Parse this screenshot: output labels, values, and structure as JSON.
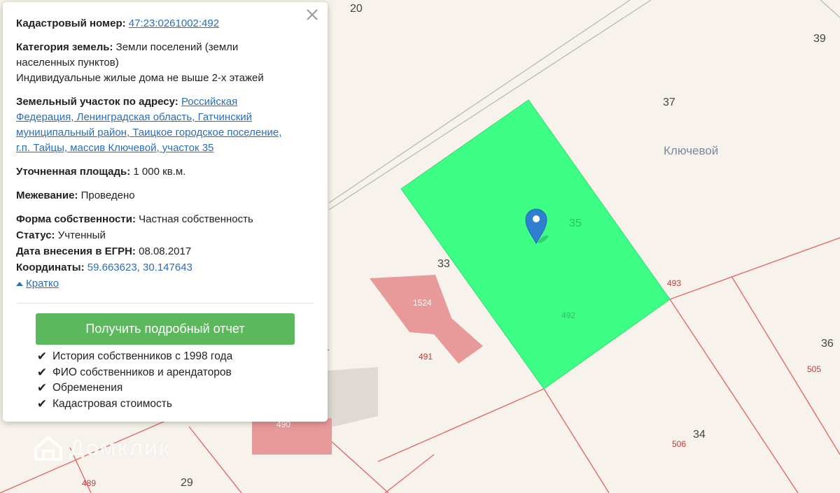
{
  "popup": {
    "cadastral_label": "Кадастровый номер:",
    "cadastral_number": "47:23:0261002:492",
    "category_label": "Категория земель:",
    "category_value_line1": "Земли поселений (земли",
    "category_value_line2": "населенных пунктов)",
    "permitted_use": "Индивидуальные жилые дома не выше 2-х этажей",
    "address_label": "Земельный участок по адресу:",
    "address_line1": "Российская",
    "address_line2": "Федерация, Ленинградская область, Гатчинский",
    "address_line3": "муниципальный район, Таицкое городское поселение,",
    "address_line4": "г.п. Тайцы, массив Ключевой, участок 35",
    "area_label": "Уточненная площадь:",
    "area_value": "1 000 кв.м.",
    "survey_label": "Межевание:",
    "survey_value": "Проведено",
    "ownership_label": "Форма собственности:",
    "ownership_value": "Частная собственность",
    "status_label": "Статус:",
    "status_value": "Учтенный",
    "egrn_date_label": "Дата внесения в ЕГРН:",
    "egrn_date_value": "08.08.2017",
    "coords_label": "Координаты:",
    "coords_value": "59.663623, 30.147643",
    "toggle_label": "Кратко",
    "report_button": "Получить подробный отчет",
    "features": [
      "История собственников с 1998 года",
      "ФИО собственников и арендаторов",
      "Обременения",
      "Кадастровая стоимость"
    ],
    "check_glyph": "✔",
    "close_icon": "close-icon"
  },
  "map": {
    "block_labels": [
      "20",
      "39",
      "37",
      "35",
      "33",
      "36",
      "34",
      "29"
    ],
    "parcel_labels": [
      "493",
      "492",
      "1524",
      "491",
      "505",
      "490",
      "506",
      "489"
    ],
    "district": "Ключевой",
    "watermark": "Домклик",
    "colors": {
      "selected_parcel": "#3dff85",
      "neighbor_parcel": "#e8999a",
      "boundary": "#e06b6b",
      "marker": "#2f7fd1"
    }
  }
}
